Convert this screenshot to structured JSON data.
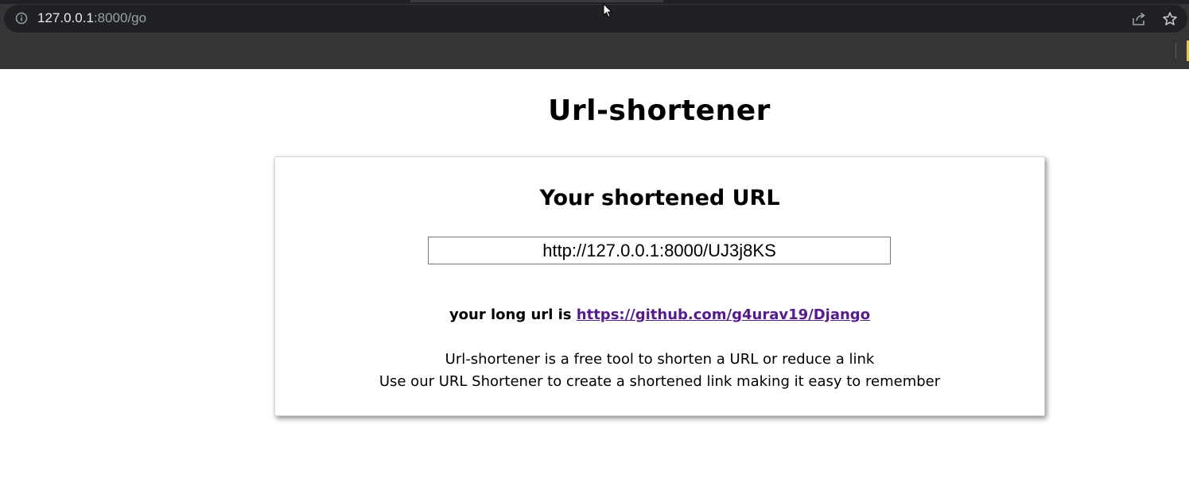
{
  "browser": {
    "url_host": "127.0.0.1",
    "url_path": ":8000/go",
    "icons": [
      "info-icon",
      "share-icon",
      "star-icon"
    ]
  },
  "page": {
    "title": "Url-shortener",
    "card": {
      "heading": "Your shortened URL",
      "short_url": "http://127.0.0.1:8000/UJ3j8KS",
      "long_url_prefix": "your long url is ",
      "long_url": "https://github.com/g4urav19/Django",
      "description_line1": "Url-shortener is a free tool to shorten a URL or reduce a link",
      "description_line2": "Use our URL Shortener to create a shortened link making it easy to remember"
    }
  },
  "colors": {
    "link": "#551a8b",
    "chrome_bg": "#353535",
    "omnibox_bg": "#202124"
  }
}
